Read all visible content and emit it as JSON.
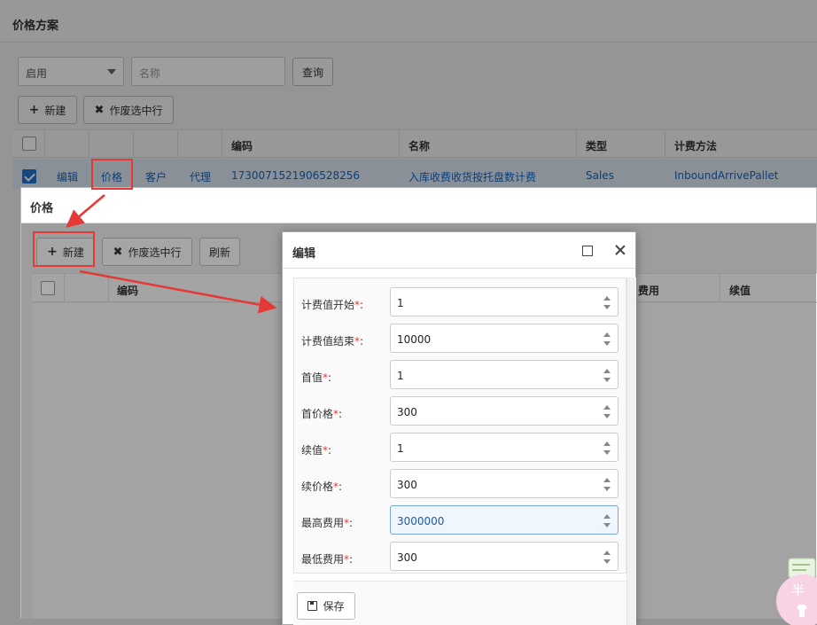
{
  "page": {
    "title": "价格方案",
    "status_select": "启用",
    "name_placeholder": "名称",
    "query_label": "查询",
    "new_label": "新建",
    "void_label": "作废选中行",
    "columns": [
      "编码",
      "名称",
      "类型",
      "计费方法"
    ],
    "row": {
      "actions": [
        "编辑",
        "价格",
        "客户",
        "代理"
      ],
      "code": "1730071521906528256",
      "name": "入库收费收货按托盘数计费",
      "type": "Sales",
      "method": "InboundArrivePallet"
    }
  },
  "price_window": {
    "title": "价格",
    "new_label": "新建",
    "void_label": "作废选中行",
    "refresh_label": "刷新",
    "columns": [
      "编码",
      "费用",
      "续值"
    ]
  },
  "edit_dialog": {
    "title": "编辑",
    "fields": [
      {
        "label": "计费值开始",
        "value": "1"
      },
      {
        "label": "计费值结束",
        "value": "10000"
      },
      {
        "label": "首值",
        "value": "1"
      },
      {
        "label": "首价格",
        "value": "300"
      },
      {
        "label": "续值",
        "value": "1"
      },
      {
        "label": "续价格",
        "value": "300"
      },
      {
        "label": "最高费用",
        "value": "3000000"
      },
      {
        "label": "最低费用",
        "value": "300"
      }
    ],
    "required_mark": "*",
    "label_suffix": ":",
    "save_label": "保存"
  },
  "sticker": {
    "char": "半"
  },
  "colors": {
    "accent": "#1e73d2",
    "annotation": "#e53935",
    "link": "#1565c0"
  }
}
